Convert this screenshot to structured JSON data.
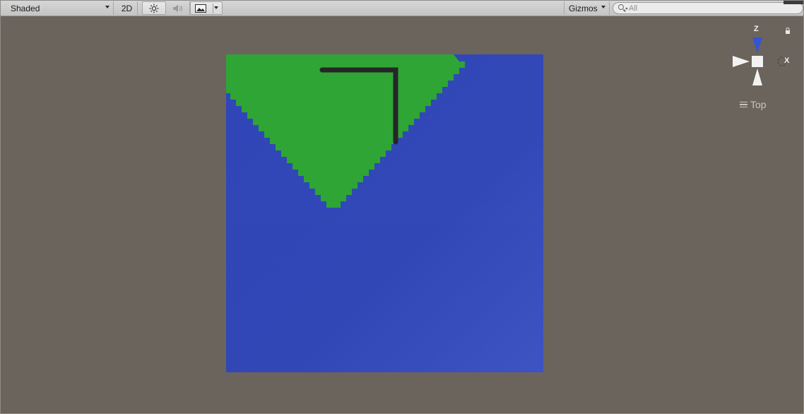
{
  "toolbar": {
    "draw_mode": "Shaded",
    "mode_2d": "2D",
    "lighting_icon": "sun-icon",
    "audio_icon": "speaker-icon",
    "effects_icon": "image-icon",
    "gizmos_label": "Gizmos",
    "search_placeholder": "All"
  },
  "gizmo": {
    "y_axis": "Z",
    "x_axis": "X",
    "view_name": "Top",
    "lock_icon": "lock-icon",
    "menu_icon": "hamburger-icon"
  },
  "scene": {
    "background_color": "#6b645c",
    "plane_color": "#3448b8",
    "region_color": "#2ea535",
    "path_color": "#222222"
  }
}
